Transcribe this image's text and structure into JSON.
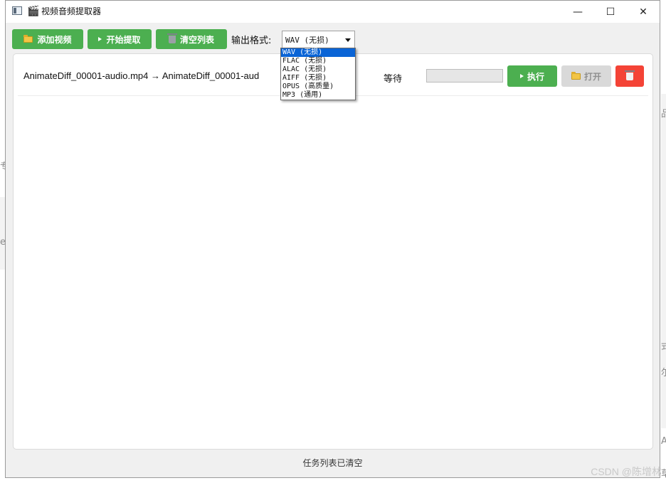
{
  "window": {
    "title": "视频音频提取器",
    "title_icon": "🎬",
    "minimize": "—",
    "maximize": "☐",
    "close": "✕"
  },
  "toolbar": {
    "add_video_label": "添加视频",
    "start_extract_label": "开始提取",
    "clear_list_label": "清空列表",
    "format_label": "输出格式:",
    "format_value": "WAV (无损)"
  },
  "format_options": [
    "WAV (无损)",
    "FLAC (无损)",
    "ALAC (无损)",
    "AIFF (无损)",
    "OPUS (高质量)",
    "MP3 (通用)"
  ],
  "tasks": [
    {
      "file": "AnimateDiff_00001-audio.mp4 → AnimateDiff_00001-aud",
      "status": "等待",
      "progress": 0,
      "run_label": "执行",
      "open_label": "打开"
    }
  ],
  "status_bar": "任务列表已清空",
  "watermark": "CSDN @陈增林",
  "colors": {
    "green": "#4caf50",
    "red": "#f44336",
    "disabled": "#d9d9d9",
    "selection": "#0a64d6"
  },
  "background_fragments": [
    "专",
    "e",
    "品",
    "式",
    "尔",
    "A",
    "草"
  ]
}
